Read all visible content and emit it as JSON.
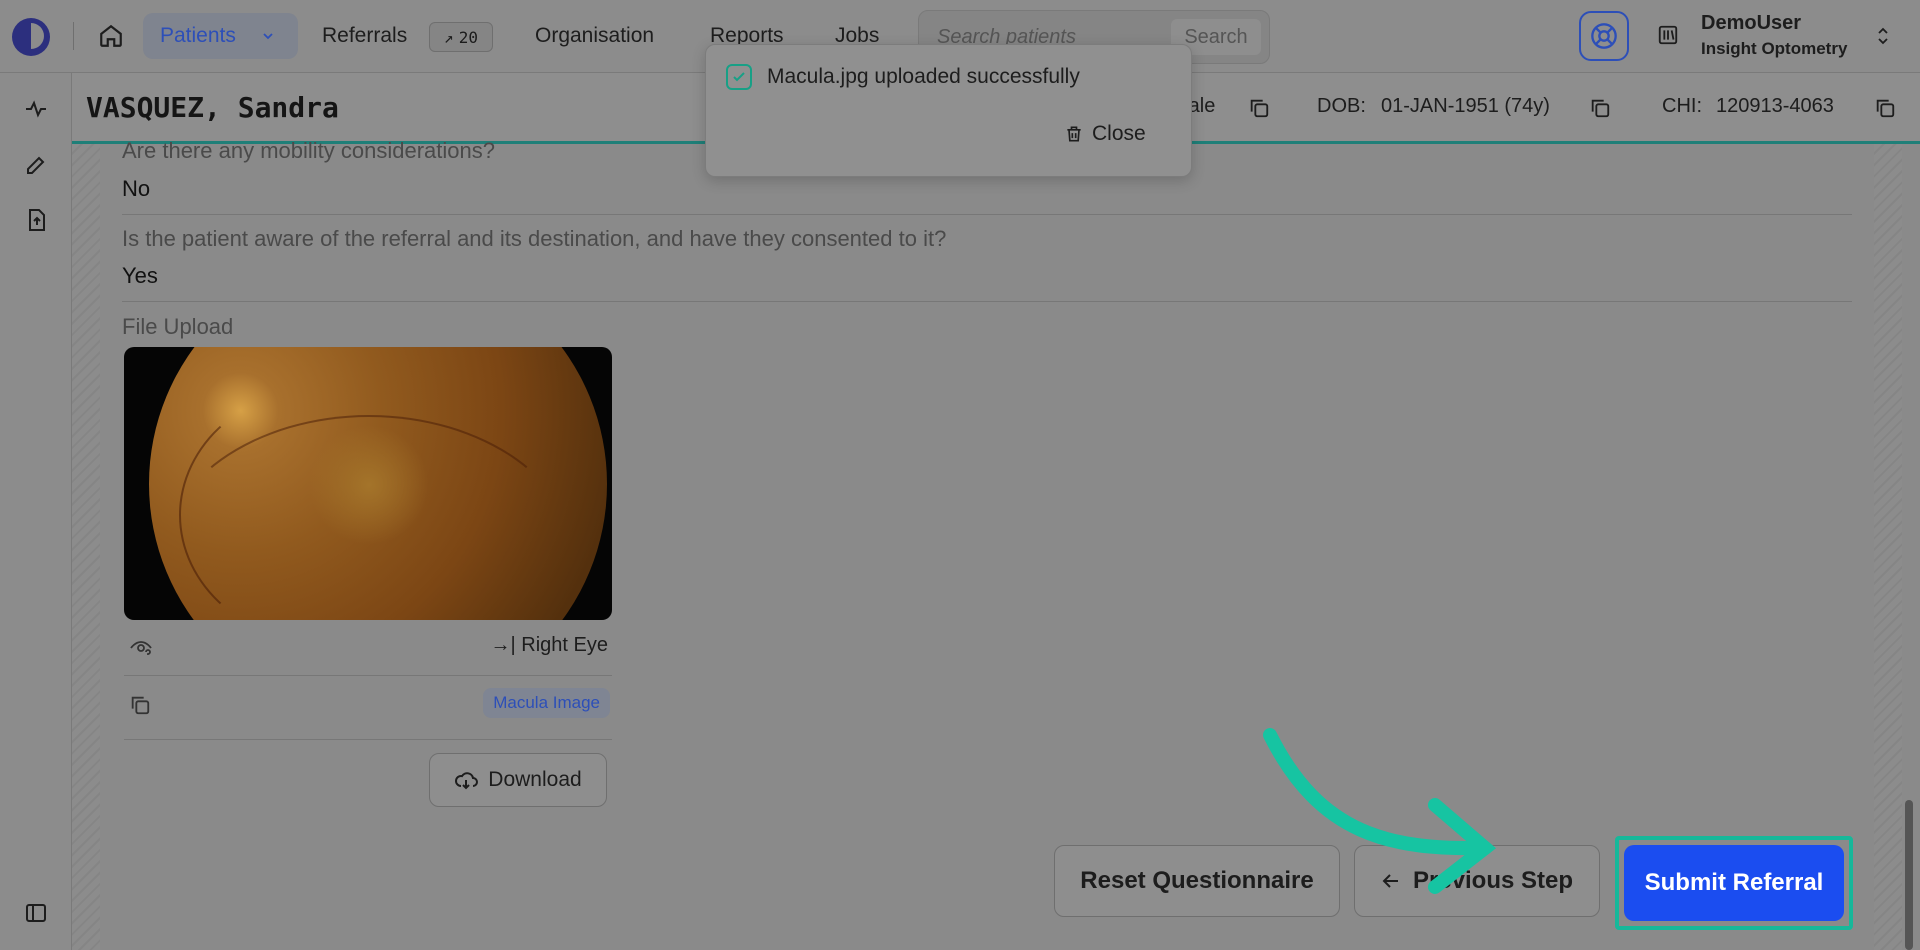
{
  "nav": {
    "patients_label": "Patients",
    "referrals_label": "Referrals",
    "referrals_count_icon": "↗",
    "referrals_count": "20",
    "organisation_label": "Organisation",
    "reports_label": "Reports",
    "jobs_label": "Jobs",
    "search_placeholder": "Search patients",
    "search_button": "Search",
    "user_name": "DemoUser",
    "user_org": "Insight Optometry"
  },
  "patient": {
    "name": "VASQUEZ, Sandra",
    "sex_value": "male",
    "dob_label": "DOB:",
    "dob_value": "01-JAN-1951 (74y)",
    "chi_label": "CHI:",
    "chi_value": "120913-4063"
  },
  "questionnaire": {
    "mobility_question": "Are there any mobility considerations?",
    "mobility_answer": "No",
    "consent_question": "Is the patient aware of the referral and its destination, and have they consented to it?",
    "consent_answer": "Yes",
    "file_upload_label": "File Upload"
  },
  "upload": {
    "eye_label": "Right Eye",
    "tag_label": "Macula Image",
    "download_label": "Download"
  },
  "actions": {
    "reset_label": "Reset Questionnaire",
    "previous_label": "Previous Step",
    "submit_label": "Submit Referral"
  },
  "toast": {
    "message": "Macula.jpg uploaded successfully",
    "close_label": "Close"
  },
  "colors": {
    "accent_blue": "#1b4df0",
    "highlight_teal": "#16b89a",
    "header_border": "#1f7f78"
  },
  "icons": [
    "home-icon",
    "chevron-down-icon",
    "help-icon",
    "library-icon",
    "pulse-icon",
    "pen-icon",
    "file-upload-icon",
    "sidebar-toggle-icon",
    "copy-icon",
    "eye-question-icon",
    "arrow-right-to-line-icon",
    "cloud-download-icon",
    "arrow-left-icon",
    "trash-icon",
    "check-icon"
  ]
}
